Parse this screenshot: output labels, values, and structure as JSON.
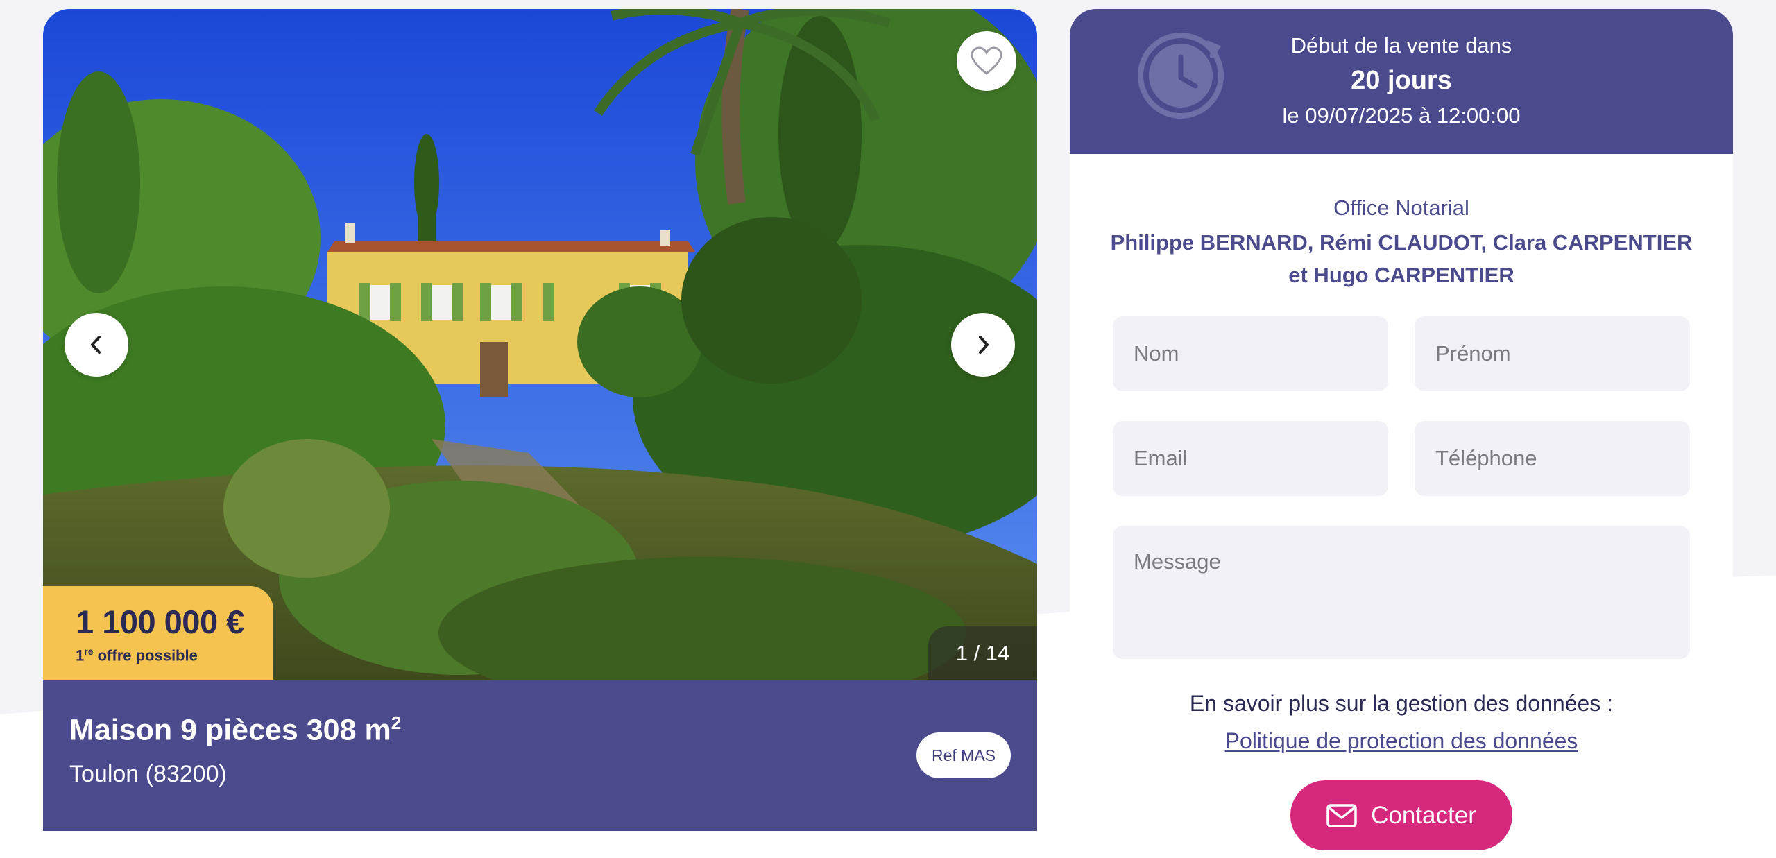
{
  "listing": {
    "price": "1 100 000 €",
    "price_note_sup": "re",
    "price_note_prefix": "1",
    "price_note_suffix": " offre possible",
    "photo_counter": "1 / 14",
    "title_main": "Maison 9 pièces 308 m",
    "title_sup": "2",
    "location": "Toulon (83200)",
    "ref": "Ref MAS"
  },
  "sale": {
    "caption": "Début de la vente dans",
    "days": "20 jours",
    "date": "le 09/07/2025 à 12:00:00"
  },
  "office": {
    "label": "Office Notarial",
    "names_line1": "Philippe BERNARD, Rémi CLAUDOT, Clara CARPENTIER",
    "names_line2": "et Hugo CARPENTIER"
  },
  "form": {
    "nom_placeholder": "Nom",
    "prenom_placeholder": "Prénom",
    "email_placeholder": "Email",
    "tel_placeholder": "Téléphone",
    "message_placeholder": "Message"
  },
  "privacy": {
    "info": "En savoir plus sur la gestion des données :",
    "link": "Politique de protection des données"
  },
  "actions": {
    "contact_label": "Contacter"
  },
  "icons": {
    "favorite": "heart-icon",
    "prev": "chevron-left-icon",
    "next": "chevron-right-icon",
    "clock": "clock-icon",
    "mail": "mail-icon"
  },
  "colors": {
    "primary": "#4a4a8c",
    "accent": "#d6297e",
    "price_badge": "#f5c350",
    "field_bg": "#f1f1f7"
  }
}
